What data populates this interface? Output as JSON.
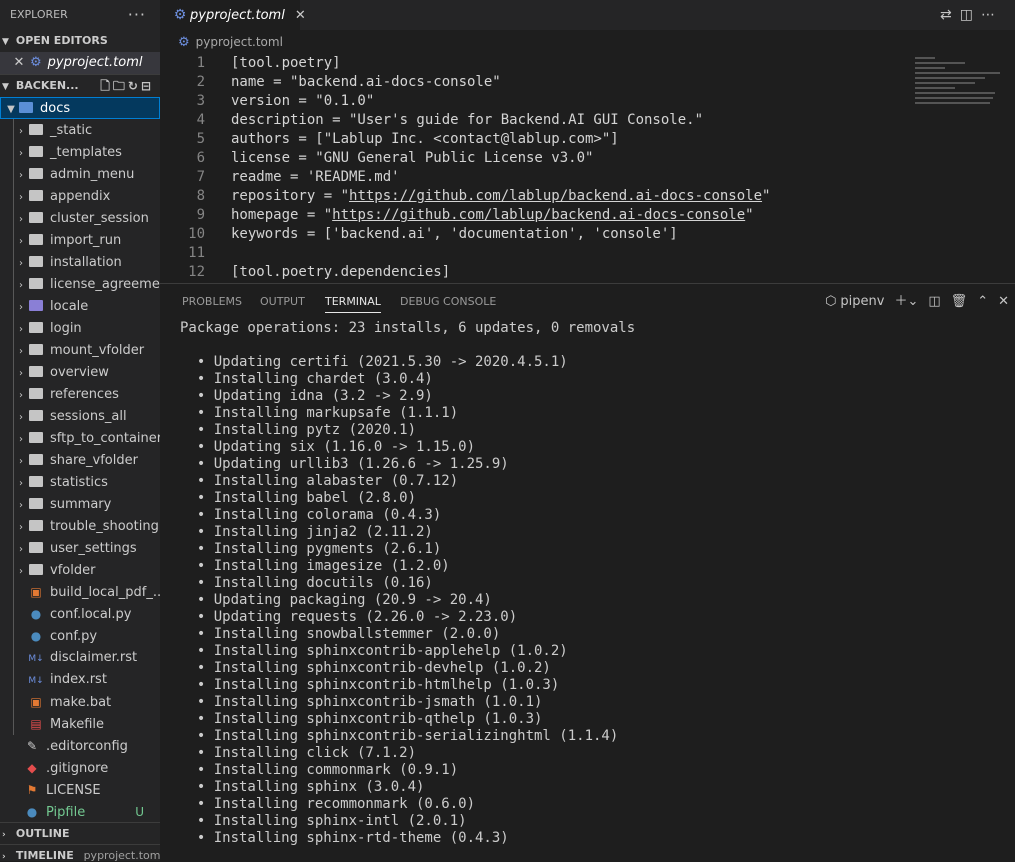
{
  "explorer": {
    "title": "EXPLORER",
    "more": "···",
    "open_editors": {
      "header": "OPEN EDITORS",
      "items": [
        {
          "close": "✕",
          "name": "pyproject.toml"
        }
      ]
    },
    "workspace": {
      "header": "BACKEN...",
      "root_folder": "docs",
      "folders": [
        "_static",
        "_templates",
        "admin_menu",
        "appendix",
        "cluster_session",
        "import_run",
        "installation",
        "license_agreeme...",
        "locale",
        "login",
        "mount_vfolder",
        "overview",
        "references",
        "sessions_all",
        "sftp_to_container",
        "share_vfolder",
        "statistics",
        "summary",
        "trouble_shooting",
        "user_settings",
        "vfolder"
      ],
      "files": [
        {
          "name": "build_local_pdf_...",
          "icon": "terminal-file-icon"
        },
        {
          "name": "conf.local.py",
          "icon": "python-icon"
        },
        {
          "name": "conf.py",
          "icon": "python-icon"
        },
        {
          "name": "disclaimer.rst",
          "icon": "markdown-icon"
        },
        {
          "name": "index.rst",
          "icon": "markdown-icon"
        },
        {
          "name": "make.bat",
          "icon": "terminal-file-icon"
        },
        {
          "name": "Makefile",
          "icon": "makefile-icon"
        }
      ],
      "root_files": [
        {
          "name": ".editorconfig",
          "icon": "editorconfig-icon",
          "badge": ""
        },
        {
          "name": ".gitignore",
          "icon": "git-icon",
          "badge": ""
        },
        {
          "name": "LICENSE",
          "icon": "license-icon",
          "badge": ""
        },
        {
          "name": "Pipfile",
          "icon": "pipfile-icon",
          "badge": "U"
        }
      ]
    },
    "outline": "OUTLINE",
    "timeline": "TIMELINE",
    "timeline_file": "pyproject.toml"
  },
  "editor": {
    "tab_label": "pyproject.toml",
    "tab_close": "✕",
    "breadcrumb": "pyproject.toml",
    "lines": [
      {
        "n": "1",
        "pre": "[tool.poetry]",
        "link": "",
        "post": ""
      },
      {
        "n": "2",
        "pre": "name = \"backend.ai-docs-console\"",
        "link": "",
        "post": ""
      },
      {
        "n": "3",
        "pre": "version = \"0.1.0\"",
        "link": "",
        "post": ""
      },
      {
        "n": "4",
        "pre": "description = \"User's guide for Backend.AI GUI Console.\"",
        "link": "",
        "post": ""
      },
      {
        "n": "5",
        "pre": "authors = [\"Lablup Inc. <contact@lablup.com>\"]",
        "link": "",
        "post": ""
      },
      {
        "n": "6",
        "pre": "license = \"GNU General Public License v3.0\"",
        "link": "",
        "post": ""
      },
      {
        "n": "7",
        "pre": "readme = 'README.md'",
        "link": "",
        "post": ""
      },
      {
        "n": "8",
        "pre": "repository = \"",
        "link": "https://github.com/lablup/backend.ai-docs-console",
        "post": "\""
      },
      {
        "n": "9",
        "pre": "homepage = \"",
        "link": "https://github.com/lablup/backend.ai-docs-console",
        "post": "\""
      },
      {
        "n": "10",
        "pre": "keywords = ['backend.ai', 'documentation', 'console']",
        "link": "",
        "post": ""
      },
      {
        "n": "11",
        "pre": "",
        "link": "",
        "post": ""
      },
      {
        "n": "12",
        "pre": "[tool.poetry.dependencies]",
        "link": "",
        "post": ""
      }
    ]
  },
  "panel": {
    "tabs": [
      "PROBLEMS",
      "OUTPUT",
      "TERMINAL",
      "DEBUG CONSOLE"
    ],
    "active_tab": "TERMINAL",
    "terminal_name": "pipenv",
    "lines": [
      "Package operations: 23 installs, 6 updates, 0 removals",
      "",
      "  • Updating certifi (2021.5.30 -> 2020.4.5.1)",
      "  • Installing chardet (3.0.4)",
      "  • Updating idna (3.2 -> 2.9)",
      "  • Installing markupsafe (1.1.1)",
      "  • Installing pytz (2020.1)",
      "  • Updating six (1.16.0 -> 1.15.0)",
      "  • Updating urllib3 (1.26.6 -> 1.25.9)",
      "  • Installing alabaster (0.7.12)",
      "  • Installing babel (2.8.0)",
      "  • Installing colorama (0.4.3)",
      "  • Installing jinja2 (2.11.2)",
      "  • Installing pygments (2.6.1)",
      "  • Installing imagesize (1.2.0)",
      "  • Installing docutils (0.16)",
      "  • Updating packaging (20.9 -> 20.4)",
      "  • Updating requests (2.26.0 -> 2.23.0)",
      "  • Installing snowballstemmer (2.0.0)",
      "  • Installing sphinxcontrib-applehelp (1.0.2)",
      "  • Installing sphinxcontrib-devhelp (1.0.2)",
      "  • Installing sphinxcontrib-htmlhelp (1.0.3)",
      "  • Installing sphinxcontrib-jsmath (1.0.1)",
      "  • Installing sphinxcontrib-qthelp (1.0.3)",
      "  • Installing sphinxcontrib-serializinghtml (1.1.4)",
      "  • Installing click (7.1.2)",
      "  • Installing commonmark (0.9.1)",
      "  • Installing sphinx (3.0.4)",
      "  • Installing recommonmark (0.6.0)",
      "  • Installing sphinx-intl (2.0.1)",
      "  • Installing sphinx-rtd-theme (0.4.3)"
    ]
  },
  "colors": {
    "accent": "#007fd4",
    "untracked": "#73c991",
    "link": "#d4d4d4"
  }
}
